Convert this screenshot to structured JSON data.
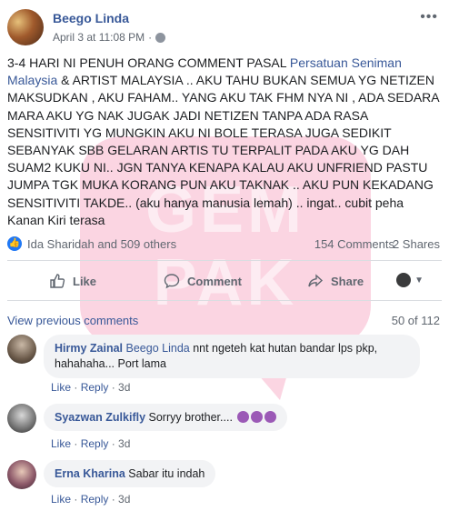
{
  "post": {
    "author": "Beego Linda",
    "timestamp": "April 3 at 11:08 PM",
    "separator": "·",
    "more_icon": "more-horizontal-icon",
    "text_before_link": "3-4 HARI NI PENUH ORANG COMMENT PASAL ",
    "link_text": "Persatuan Seniman Malaysia",
    "text_after_link": " & ARTIST MALAYSIA .. AKU TAHU BUKAN SEMUA YG NETIZEN MAKSUDKAN , AKU FAHAM.. YANG AKU TAK FHM NYA NI , ADA SEDARA MARA AKU YG NAK JUGAK JADI NETIZEN TANPA ADA RASA SENSITIVITI YG MUNGKIN AKU NI BOLE TERASA JUGA SEDIKIT SEBANYAK SBB GELARAN ARTIS TU TERPALIT PADA AKU YG DAH SUAM2 KUKU NI.. JGN TANYA KENAPA KALAU AKU UNFRIEND PASTU JUMPA TGK MUKA KORANG PUN AKU TAKNAK .. AKU PUN KEKADANG SENSITIVITI TAKDE.. (aku hanya manusia lemah) .. ingat.. cubit peha Kanan Kiri terasa"
  },
  "reactions": {
    "reactors": "Ida Sharidah and 509 others",
    "comments": "154 Comments",
    "shares": "2 Shares"
  },
  "actions": {
    "like": "Like",
    "comment": "Comment",
    "share": "Share"
  },
  "comments_section": {
    "view_previous": "View previous comments",
    "page_count": "50 of 112",
    "items": [
      {
        "author": "Hirmy Zainal",
        "mention": "Beego Linda",
        "text": " nnt ngeteh kat hutan bandar lps pkp, hahahaha... Port lama",
        "like": "Like",
        "reply": "Reply",
        "time": "3d"
      },
      {
        "author": "Syazwan Zulkifly",
        "text": "Sorryy brother....",
        "like": "Like",
        "reply": "Reply",
        "time": "3d"
      },
      {
        "author": "Erna Kharina",
        "text": "Sabar itu indah",
        "like": "Like",
        "reply": "Reply",
        "time": "3d"
      }
    ]
  },
  "watermark": {
    "line1": "GEM",
    "line2": "PAK"
  },
  "colors": {
    "link": "#385898",
    "meta": "#606770",
    "bubble": "#f2f3f5",
    "like_badge": "#2078f4",
    "watermark": "#ec407a"
  }
}
